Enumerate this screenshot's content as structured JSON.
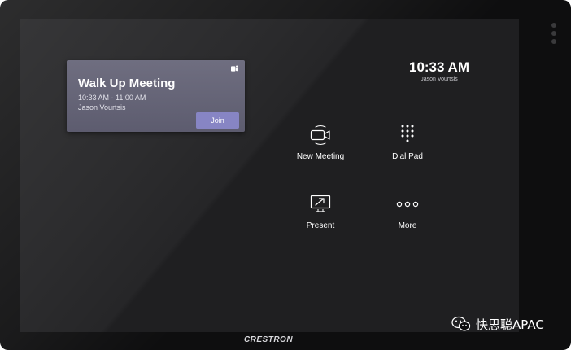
{
  "meeting_card": {
    "title": "Walk Up Meeting",
    "time": "10:33 AM - 11:00 AM",
    "organizer": "Jason Vourtsis",
    "join_label": "Join",
    "icon": "teams-icon"
  },
  "clock": {
    "time": "10:33 AM",
    "user": "Jason Vourtsis"
  },
  "actions": [
    {
      "label": "New Meeting",
      "icon": "video-camera-icon"
    },
    {
      "label": "Dial Pad",
      "icon": "dial-pad-icon"
    },
    {
      "label": "Present",
      "icon": "present-screen-icon"
    },
    {
      "label": "More",
      "icon": "more-dots-icon"
    }
  ],
  "device": {
    "brand": "CRESTRON"
  },
  "watermark": {
    "text": "快思聪APAC",
    "icon": "wechat-icon"
  },
  "colors": {
    "card_background": "#6f6e80",
    "join_button": "#8785c4",
    "screen_background": "#1f1f21",
    "bezel": "#0e0e0f"
  }
}
